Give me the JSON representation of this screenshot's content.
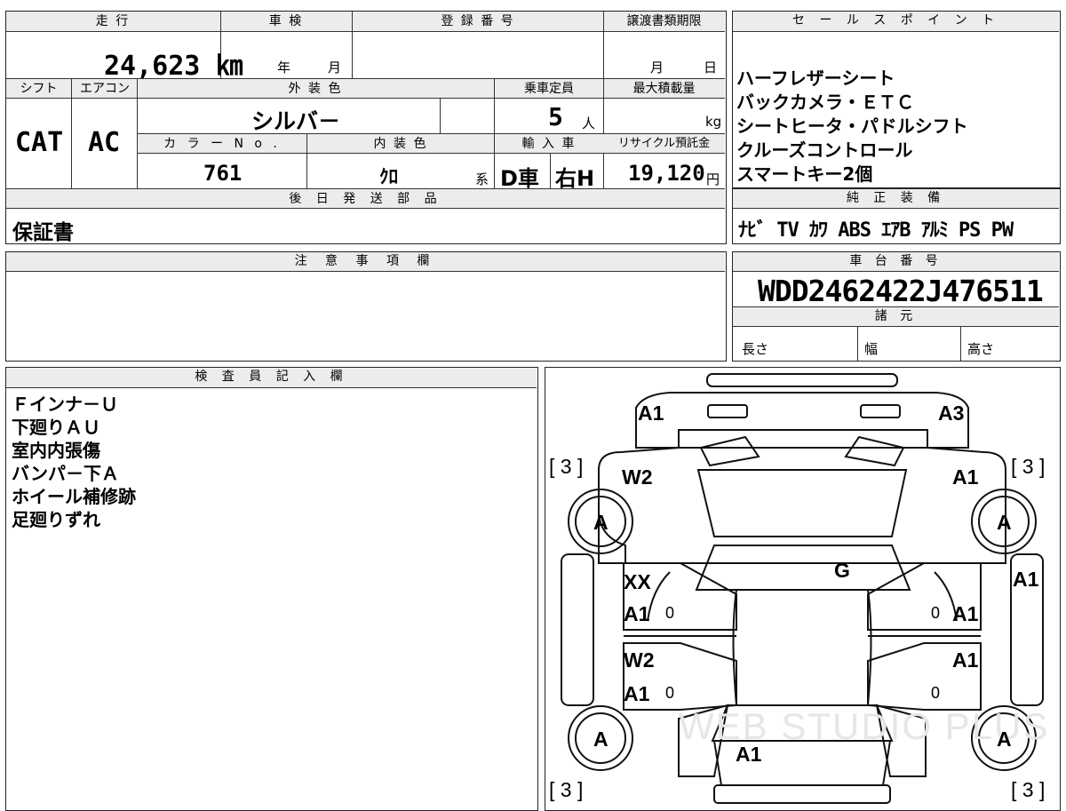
{
  "top_left": {
    "mileage_label": "走 行",
    "mileage_value": "24,623 ㎞",
    "inspection_label": "車 検",
    "year_label": "年",
    "month_label": "月",
    "registration_label": "登 録 番 号",
    "transfer_label": "譲渡書類期限",
    "transfer_month": "月",
    "transfer_day": "日",
    "shift_label": "シフト",
    "ac_label": "エアコン",
    "exterior_label": "外 装 色",
    "capacity_label": "乗車定員",
    "load_label": "最大積載量",
    "shift_value": "CAT",
    "ac_value": "AC",
    "exterior_value": "シルバ－",
    "capacity_value": "5",
    "capacity_unit": "人",
    "load_unit": "kg",
    "color_no_label": "カ ラ ー N o .",
    "interior_label": "内 装 色",
    "import_label": "輸 入 車",
    "recycle_label": "リサイクル預託金",
    "color_no_value": "761",
    "interior_value": "ｸﾛ",
    "interior_suffix": "系",
    "import_drive": "D車",
    "import_handle": "右H",
    "recycle_value": "19,120",
    "recycle_unit": "円",
    "later_parts_label": "後 日 発 送 部 品",
    "later_parts_value": "保証書"
  },
  "sales_points": {
    "title": "セ ー ル ス ポ イ ン ト",
    "lines": [
      "ハーフレザーシート",
      "バックカメラ・ＥＴＣ",
      "シートヒータ・パドルシフト",
      "クルーズコントロール",
      "スマートキー2個"
    ]
  },
  "equipment": {
    "title": "純 正 装 備",
    "value": "ﾅﾋﾞ TV ｶﾜ ABS ｴｱB ｱﾙﾐ PS PW"
  },
  "notes": {
    "title": "注 意 事 項 欄"
  },
  "chassis": {
    "title": "車 台 番 号",
    "value": "WDD2462422J476511",
    "specs_title": "諸 元",
    "length_label": "長さ",
    "width_label": "幅",
    "height_label": "高さ"
  },
  "inspector": {
    "title": "検 査 員 記 入 欄",
    "lines": [
      "Ｆインナ－Ｕ",
      "下廻りＡＵ",
      "室内内張傷",
      "バンパ－下Ａ",
      "ホイール補修跡",
      "足廻りずれ"
    ]
  },
  "diagram": {
    "marks": {
      "front_left": "A1",
      "front_right": "A3",
      "fender_left": "W2",
      "fender_right": "A1",
      "tyre_fl": "A",
      "tyre_fr": "A",
      "tyre_rl": "A",
      "tyre_rr": "A",
      "windshield": "G",
      "side_right": "A1",
      "door_fl_1": "XX",
      "door_fl_2": "A1",
      "door_fr": "A1",
      "door_rl_1": "W2",
      "door_rl_2": "A1",
      "door_rr": "A1",
      "rear": "A1",
      "zero_mark": "0",
      "tread_fl": "[ 3 ]",
      "tread_fr": "[ 3 ]",
      "tread_rl": "[ 3 ]",
      "tread_rr": "[ 3 ]"
    },
    "watermark": "WEB STUDIO PLUS"
  }
}
